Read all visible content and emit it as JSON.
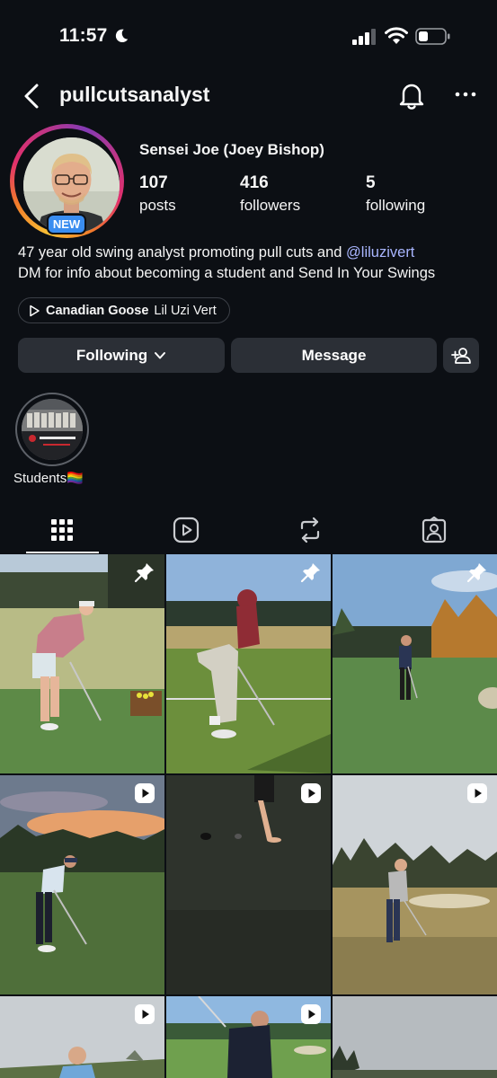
{
  "status_bar": {
    "time": "11:57"
  },
  "header": {
    "username": "pullcutsanalyst"
  },
  "profile": {
    "full_name": "Sensei Joe (Joey Bishop)",
    "badge": "NEW",
    "stats": [
      {
        "value": "107",
        "label": "posts"
      },
      {
        "value": "416",
        "label": "followers"
      },
      {
        "value": "5",
        "label": "following"
      }
    ],
    "bio_line1_prefix": "47 year old swing analyst promoting pull cuts and ",
    "bio_mention": "@liluzivert",
    "bio_line2": "DM for info about becoming a student and Send In Your Swings",
    "music": {
      "song": "Canadian Goose",
      "artist": "Lil Uzi Vert"
    }
  },
  "buttons": {
    "following": "Following",
    "message": "Message"
  },
  "highlights": [
    {
      "label": "Students🏳️‍🌈"
    }
  ],
  "tabs": [
    "posts-grid",
    "reels",
    "reposts",
    "tagged"
  ],
  "grid": [
    {
      "type": "pinned",
      "icon": "pin-icon"
    },
    {
      "type": "pinned",
      "icon": "pin-icon"
    },
    {
      "type": "pinned",
      "icon": "pin-icon"
    },
    {
      "type": "reel",
      "icon": "reel-icon"
    },
    {
      "type": "reel",
      "icon": "reel-icon"
    },
    {
      "type": "reel",
      "icon": "reel-icon"
    },
    {
      "type": "reel",
      "icon": "reel-icon"
    },
    {
      "type": "reel",
      "icon": "reel-icon"
    },
    {
      "type": "post",
      "icon": ""
    }
  ]
}
